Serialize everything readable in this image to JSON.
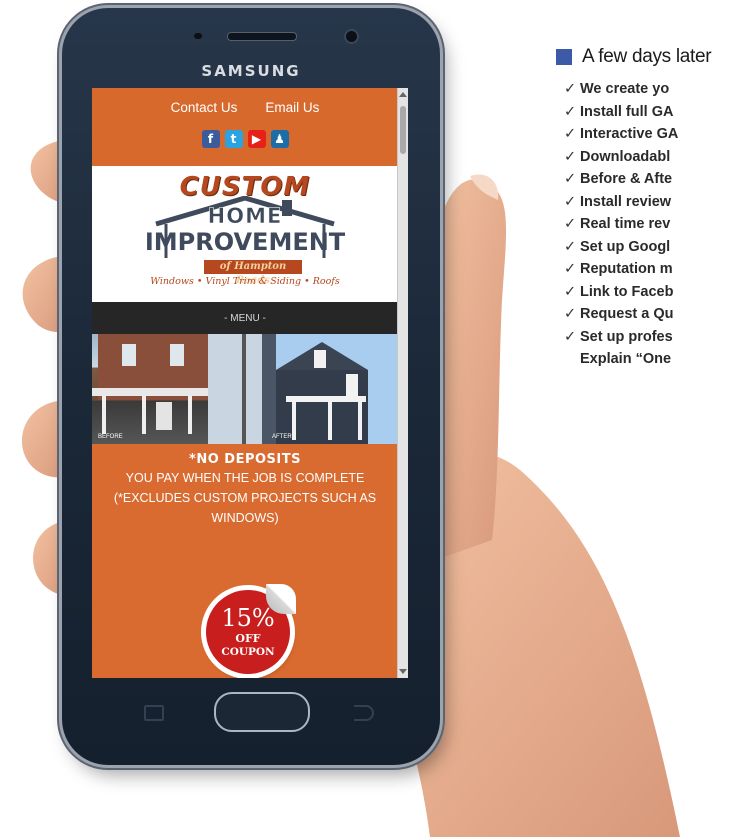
{
  "device": {
    "brand": "SAMSUNG"
  },
  "website": {
    "header": {
      "contact_label": "Contact Us",
      "email_label": "Email Us",
      "social_icons": [
        "facebook-icon",
        "twitter-icon",
        "youtube-icon",
        "bbb-icon"
      ]
    },
    "logo": {
      "line1": "CUSTOM",
      "line2": "HOME",
      "line3": "IMPROVEMENT",
      "line4": "of Hampton Roads",
      "tagline": "Windows • Vinyl Trim & Siding • Roofs"
    },
    "menu_label": "- MENU -",
    "photos": {
      "before_label": "BEFORE",
      "after_label": "AFTER"
    },
    "promo": {
      "title": "*NO DEPOSITS",
      "line1": "YOU PAY WHEN THE JOB IS COMPLETE",
      "line2": "(*EXCLUDES CUSTOM PROJECTS SUCH AS",
      "line3": "WINDOWS)"
    },
    "coupon": {
      "percent": "15%",
      "off": "OFF",
      "word": "COUPON"
    }
  },
  "right_copy": {
    "heading": "A few days later",
    "items": [
      "We create yo",
      "Install full GA",
      "Interactive GA",
      "Downloadabl",
      "Before & Afte",
      "Install review",
      "Real time rev",
      "Set up Googl",
      "Reputation m",
      "Link to Faceb",
      "Request a Qu",
      "Set up profes"
    ],
    "last_item_continuation": "Explain “One"
  },
  "colors": {
    "site_orange": "#d96b30",
    "menu_bar": "#262626",
    "heading_square": "#3d5aa8",
    "coupon_red": "#c81e1e"
  }
}
